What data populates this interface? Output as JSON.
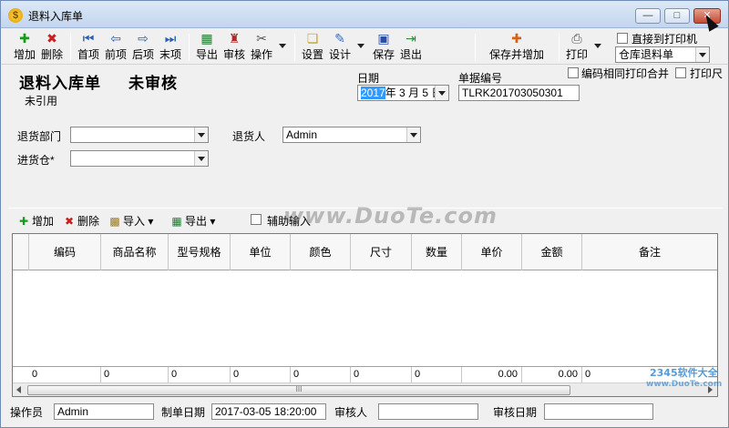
{
  "window": {
    "title": "退料入库单"
  },
  "toolbar": {
    "add": "增加",
    "delete": "删除",
    "first": "首项",
    "prev": "前项",
    "next": "后项",
    "last": "末项",
    "export": "导出",
    "audit": "审核",
    "operate": "操作",
    "settings": "设置",
    "design": "设计",
    "save": "保存",
    "exit": "退出",
    "save_add": "保存并增加",
    "print": "打印",
    "direct_print": "直接到打印机",
    "print_template": "仓库退料单",
    "merge_print": "编码相同打印合并",
    "print_more": "打印尺"
  },
  "form": {
    "title": "退料入库单",
    "status": "未审核",
    "ref_status": "未引用",
    "date_label": "日期",
    "date_year": "2017",
    "date_rest": "年 3 月 5 日",
    "doc_no_label": "单据编号",
    "doc_no": "TLRK201703050301",
    "dept_label": "退货部门",
    "dept_value": "",
    "returner_label": "退货人",
    "returner_value": "Admin",
    "warehouse_label": "进货仓*",
    "warehouse_value": ""
  },
  "grid_toolbar": {
    "add": "增加",
    "delete": "删除",
    "import": "导入",
    "export": "导出",
    "aux_input": "辅助输入"
  },
  "grid": {
    "columns": [
      "编码",
      "商品名称",
      "型号规格",
      "单位",
      "颜色",
      "尺寸",
      "数量",
      "单价",
      "金额",
      "备注"
    ],
    "totals": [
      "0",
      "0",
      "0",
      "0",
      "0",
      "0",
      "0",
      "0.00",
      "0.00",
      "0"
    ],
    "scroll_grip": "III"
  },
  "statusbar": {
    "operator_label": "操作员",
    "operator": "Admin",
    "created_label": "制单日期",
    "created": "2017-03-05 18:20:00",
    "auditor_label": "审核人",
    "auditor": "",
    "audit_date_label": "审核日期",
    "audit_date": ""
  },
  "watermarks": {
    "center": "www.DuoTe.com",
    "brand": "2345软件大全",
    "brand_url": "www.DuoTe.com"
  },
  "colors": {
    "selection": "#3399ff",
    "titlebar": "#c3d6ee",
    "close": "#c44b35"
  }
}
